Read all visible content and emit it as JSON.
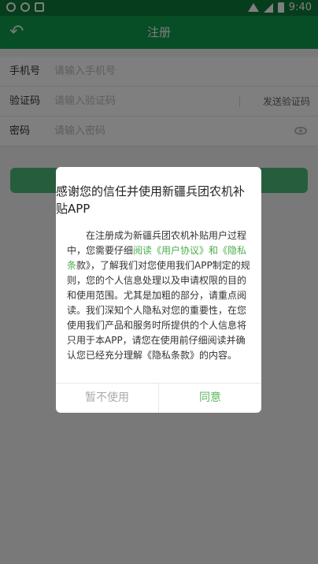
{
  "status_bar": {
    "time": "9:40",
    "colors": {
      "bg": "#0c7a3a"
    }
  },
  "app_bar": {
    "title": "注册",
    "back_icon": "arrow-left",
    "color": "#0f9a4a"
  },
  "form": {
    "phone": {
      "label": "手机号",
      "placeholder": "请输入手机号"
    },
    "code": {
      "label": "验证码",
      "placeholder": "请输入验证码",
      "send_button": "发送验证码"
    },
    "password": {
      "label": "密码",
      "placeholder": "请输入密码",
      "toggle_icon": "eye"
    }
  },
  "dialog": {
    "title_line1": "感谢您的信任并使用新疆兵团农机补",
    "title_line2": "贴APP",
    "body_pre": "在注册成为新疆兵团农机补贴用户过程中，您需要仔细",
    "link_text": "阅读《用户协议》和《隐私条",
    "body_post": "款》，了解我们对您使用我们APP制定的规则，您的个人信息处理以及申请权限的目的和使用范围。尤其是加粗的部分，请重点阅读。我们深知个人隐私对您的重要性，在您使用我们产品和服务时所提供的个人信息将只用于本APP，请您在使用前仔细阅读并确认您已经充分理解《隐私条款》的内容。",
    "cancel": "暂不使用",
    "confirm": "同意",
    "accent": "#5cb85c"
  }
}
